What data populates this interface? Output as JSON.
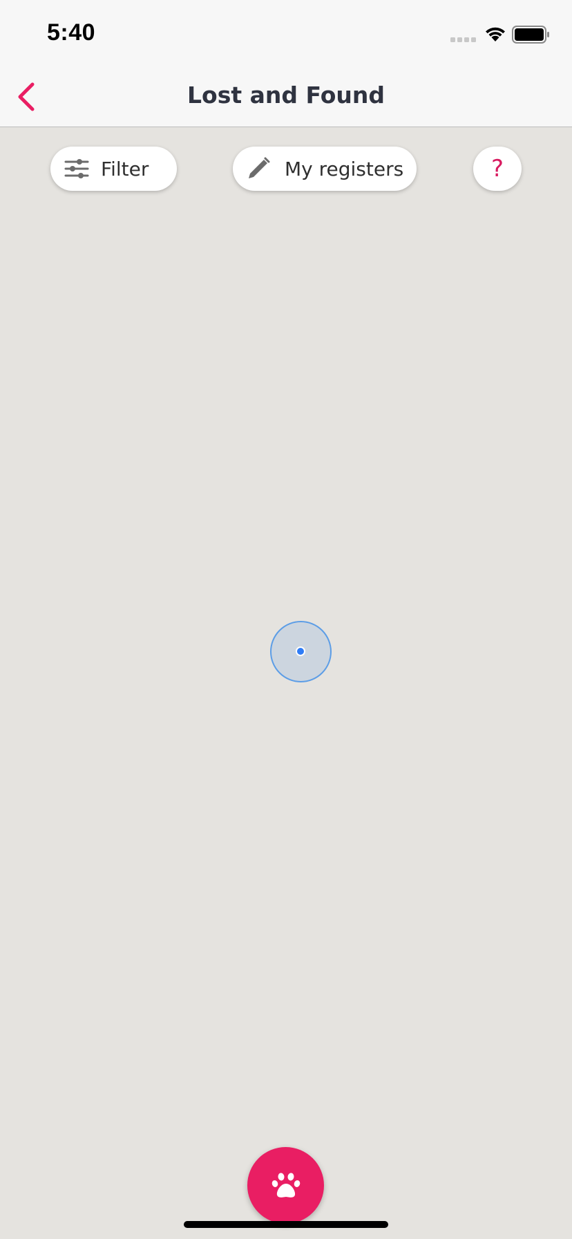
{
  "status_bar": {
    "time": "5:40"
  },
  "nav": {
    "title": "Lost and Found",
    "back_icon": "chevron-left-icon"
  },
  "toolbar": {
    "filter_label": "Filter",
    "filter_icon": "sliders-icon",
    "registers_label": "My registers",
    "registers_icon": "pencil-icon",
    "help_label": "?",
    "help_icon": "question-mark-icon"
  },
  "fab": {
    "icon": "paw-icon"
  },
  "colors": {
    "accent": "#e91e63",
    "map_background": "#e5e3df",
    "location_dot": "#2f7cf6"
  }
}
